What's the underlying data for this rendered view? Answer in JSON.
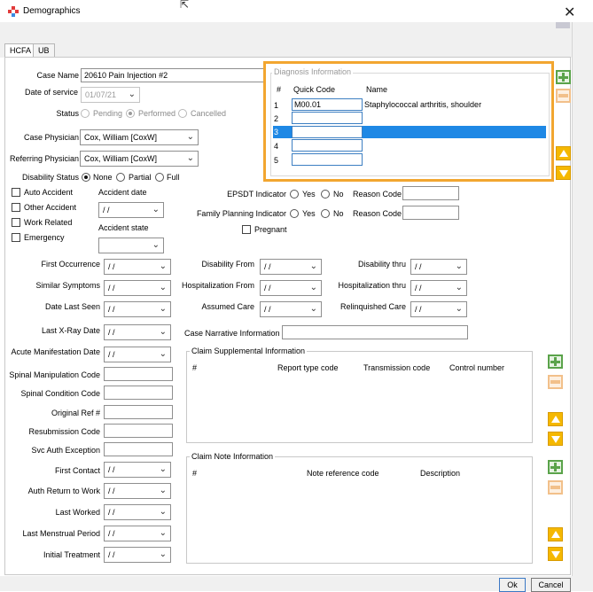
{
  "window": {
    "title": "Demographics"
  },
  "tabs": [
    {
      "label": "HCFA"
    },
    {
      "label": "UB"
    }
  ],
  "case": {
    "case_name_label": "Case Name",
    "case_name_value": "20610 Pain Injection #2",
    "date_of_service_label": "Date of service",
    "date_of_service_value": "01/07/21",
    "status_label": "Status",
    "status_options": [
      "Pending",
      "Performed",
      "Cancelled"
    ],
    "case_physician_label": "Case Physician",
    "case_physician_value": "Cox, William  [CoxW]",
    "referring_physician_label": "Referring Physician",
    "referring_physician_value": "Cox, William  [CoxW]",
    "disability_status_label": "Disability Status",
    "disability_options": [
      "None",
      "Partial",
      "Full"
    ]
  },
  "checkboxes": [
    "Auto Accident",
    "Other Accident",
    "Work Related",
    "Emergency"
  ],
  "accident": {
    "date_label": "Accident date",
    "date_value": "/ /",
    "state_label": "Accident state"
  },
  "indicators": {
    "epsdt_label": "EPSDT Indicator",
    "family_planning_label": "Family Planning Indicator",
    "yes": "Yes",
    "no": "No",
    "reason_code_label": "Reason Code",
    "pregnant_label": "Pregnant"
  },
  "diagnosis": {
    "title": "Diagnosis Information",
    "headers": {
      "num": "#",
      "quick_code": "Quick Code",
      "name": "Name"
    },
    "rows": [
      {
        "n": "1",
        "code": "M00.01",
        "name": "Staphylococcal arthritis, shoulder"
      },
      {
        "n": "2",
        "code": "",
        "name": ""
      },
      {
        "n": "3",
        "code": "",
        "name": ""
      },
      {
        "n": "4",
        "code": "",
        "name": ""
      },
      {
        "n": "5",
        "code": "",
        "name": ""
      }
    ]
  },
  "date_fields": {
    "blank": "/ /",
    "left": [
      "First Occurrence",
      "Similar Symptoms",
      "Date Last Seen",
      "Last X-Ray Date",
      "Acute Manifestation Date"
    ],
    "middle": [
      "Disability From",
      "Hospitalization From",
      "Assumed Care"
    ],
    "right": [
      "Disability thru",
      "Hospitalization thru",
      "Relinquished Care"
    ],
    "case_narrative_label": "Case Narrative Information"
  },
  "code_fields": [
    "Spinal Manipulation Code",
    "Spinal Condition Code",
    "Original Ref #",
    "Resubmission Code",
    "Svc Auth Exception"
  ],
  "lower_dates": [
    "First Contact",
    "Auth Return to Work",
    "Last Worked",
    "Last Menstrual Period",
    "Initial Treatment"
  ],
  "claim_supplemental": {
    "title": "Claim Supplemental Information",
    "headers": [
      "#",
      "Report type code",
      "Transmission code",
      "Control number"
    ]
  },
  "claim_note": {
    "title": "Claim Note Information",
    "headers": [
      "#",
      "Note reference code",
      "Description"
    ]
  },
  "buttons": {
    "ok": "Ok",
    "cancel": "Cancel"
  },
  "colors": {
    "highlight": "#f2a630",
    "selection": "#1e88e5",
    "accent_green": "#5aa34a",
    "accent_yellow": "#f5b800"
  }
}
